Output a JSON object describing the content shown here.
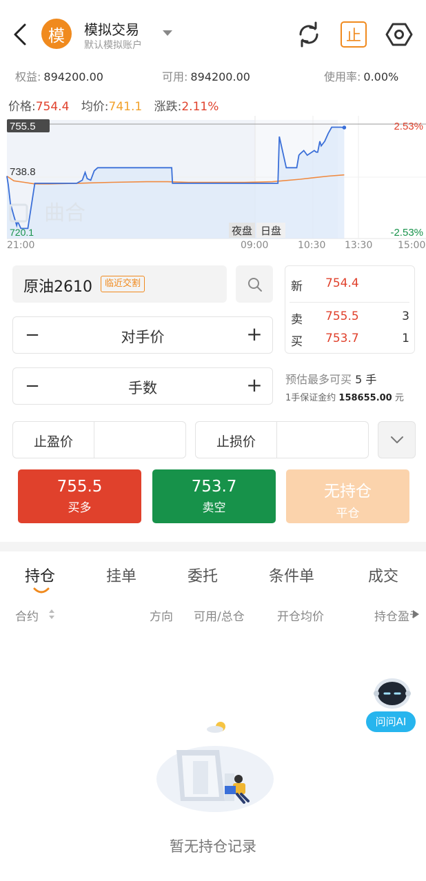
{
  "header": {
    "logo_char": "模",
    "title": "模拟交易",
    "subtitle": "默认模拟账户",
    "stop_label": "止",
    "icons": [
      "back-icon",
      "caret-down-icon",
      "refresh-icon",
      "stop-icon",
      "settings-icon"
    ]
  },
  "account": {
    "equity_label": "权益:",
    "equity": "894200.00",
    "available_label": "可用:",
    "available": "894200.00",
    "usage_label": "使用率:",
    "usage": "0.00%"
  },
  "price_row": {
    "price_label": "价格:",
    "price": "754.4",
    "avg_label": "均价:",
    "avg": "741.1",
    "change_label": "涨跌:",
    "change": "2.11%"
  },
  "chart_data": {
    "type": "line",
    "ylim": [
      720.1,
      755.5
    ],
    "y_labels": {
      "top": "755.5",
      "mid": "738.8",
      "bottom": "720.1"
    },
    "right_labels": {
      "top": "2.53%",
      "bottom": "-2.53%"
    },
    "x_ticks": [
      "21:00",
      "09:00",
      "10:30",
      "13:30",
      "15:00"
    ],
    "session_labels": [
      "夜盘",
      "日盘"
    ],
    "watermark": "曲合",
    "series": [
      {
        "x": [
          0,
          2,
          5,
          10,
          14,
          15,
          16,
          20,
          24,
          30,
          40,
          50,
          70,
          76,
          80,
          90,
          100,
          108,
          112,
          115,
          120,
          125,
          130,
          160,
          170,
          200,
          205,
          210,
          236,
          237,
          260,
          300,
          340,
          360,
          388,
          390,
          400,
          410,
          415,
          418,
          420,
          425,
          430,
          440,
          443,
          445,
          448,
          450,
          455,
          460,
          465,
          470,
          478,
          483
        ],
        "values": [
          738.8,
          736,
          730,
          726,
          723,
          724,
          724,
          722,
          722,
          722,
          736.5,
          736.5,
          736.5,
          736.5,
          736.5,
          736.5,
          736.5,
          737.5,
          740,
          738,
          737.5,
          740.5,
          741.5,
          741.5,
          741.5,
          741.5,
          741.5,
          741.5,
          741.5,
          736.5,
          736.5,
          736.5,
          736.5,
          736.5,
          736.5,
          751.5,
          741.5,
          741.5,
          741.5,
          745.5,
          746,
          747,
          745.5,
          747,
          746.5,
          746.5,
          750,
          748.5,
          750,
          752.5,
          754.5,
          754.5,
          754.5,
          754.4
        ]
      },
      {
        "x": [
          0,
          10,
          25,
          40,
          60,
          100,
          150,
          200,
          230,
          260,
          300,
          340,
          380,
          420,
          440,
          460,
          483
        ],
        "values": [
          738.8,
          737.3,
          736.8,
          736.3,
          736.3,
          736.5,
          736.8,
          737,
          737,
          736.8,
          736.8,
          736.8,
          737,
          737.8,
          738.3,
          738.8,
          739.2
        ]
      }
    ]
  },
  "order": {
    "contract": "原油2610",
    "near_delivery_tag": "临近交割",
    "price_type": "对手价",
    "quantity_label": "手数",
    "minus": "−",
    "plus": "+"
  },
  "quote": {
    "last_label": "新",
    "last": "754.4",
    "ask_label": "卖",
    "ask": "755.5",
    "ask_qty": "3",
    "bid_label": "买",
    "bid": "753.7",
    "bid_qty": "1"
  },
  "estimate": {
    "prefix": "预估最多可买",
    "max_qty": "5",
    "unit": "手",
    "margin_label": "1手保证金约",
    "margin": "158655.00",
    "margin_unit": "元"
  },
  "stops": {
    "take_profit": "止盈价",
    "stop_loss": "止损价"
  },
  "buttons": {
    "buy_price": "755.5",
    "buy_label": "买多",
    "sell_price": "753.7",
    "sell_label": "卖空",
    "close_title": "无持仓",
    "close_label": "平仓"
  },
  "tabs": [
    "持仓",
    "挂单",
    "委托",
    "条件单",
    "成交"
  ],
  "columns": [
    "合约",
    "方向",
    "可用/总仓",
    "开仓均价",
    "持仓盈亏"
  ],
  "ai": {
    "label": "问问AI"
  },
  "empty": {
    "text": "暂无持仓记录"
  },
  "colors": {
    "red": "#e0412c",
    "green": "#17924a",
    "orange": "#f08a1e",
    "gold": "#f2a12a",
    "blue": "#3a6fd8"
  }
}
